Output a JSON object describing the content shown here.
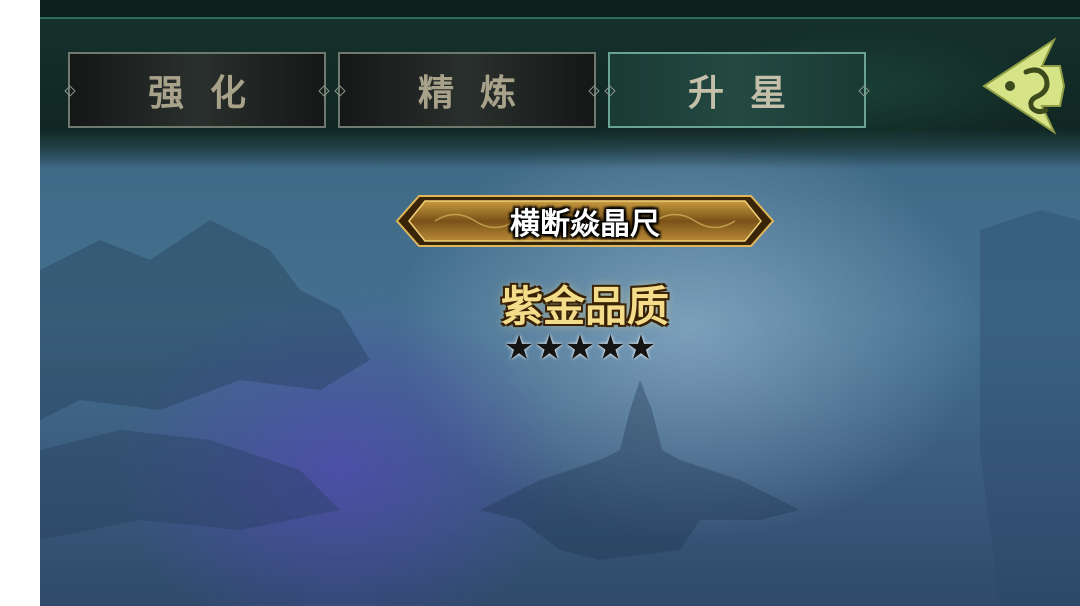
{
  "tabs": [
    {
      "label": "强化",
      "active": false
    },
    {
      "label": "精炼",
      "active": false
    },
    {
      "label": "升星",
      "active": true
    }
  ],
  "item": {
    "name": "横断焱晶尺",
    "quality": "紫金品质",
    "stars": "★★★★★",
    "star_count": 5
  },
  "icons": {
    "back": "back-arrow-icon"
  },
  "colors": {
    "header_bg": "#112723",
    "tab_border": "#6e7a6f",
    "tab_active_border": "#6aa394",
    "gold": "#f3dc8a",
    "back_icon": "#d6e487"
  }
}
